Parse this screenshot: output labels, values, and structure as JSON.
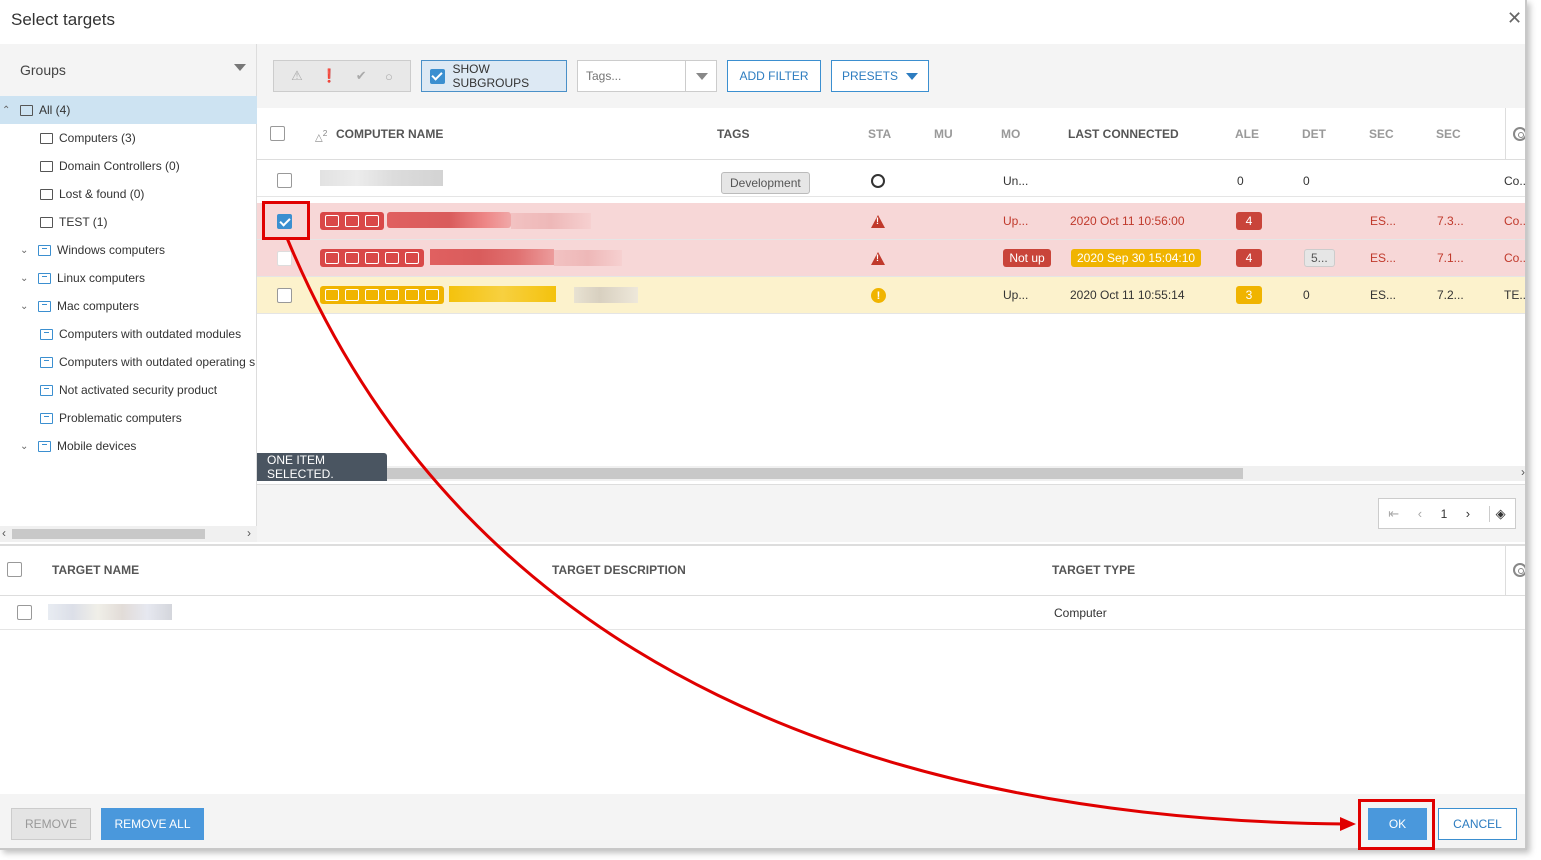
{
  "dialog": {
    "title": "Select targets"
  },
  "groups": {
    "header": "Groups",
    "items": [
      {
        "label": "All (4)",
        "level": 0,
        "expander": "collapse",
        "icon": "folder-icon",
        "active": true
      },
      {
        "label": "Computers (3)",
        "level": 1,
        "expander": "",
        "icon": "folder-icon"
      },
      {
        "label": "Domain Controllers (0)",
        "level": 1,
        "expander": "",
        "icon": "folder-icon"
      },
      {
        "label": "Lost & found (0)",
        "level": 1,
        "expander": "",
        "icon": "folder-icon"
      },
      {
        "label": "TEST (1)",
        "level": 1,
        "expander": "",
        "icon": "folder-icon"
      },
      {
        "label": "Windows computers",
        "level": 1,
        "expander": "expand",
        "icon": "dynamic-group-icon"
      },
      {
        "label": "Linux computers",
        "level": 1,
        "expander": "expand",
        "icon": "dynamic-group-icon"
      },
      {
        "label": "Mac computers",
        "level": 1,
        "expander": "expand",
        "icon": "dynamic-group-icon"
      },
      {
        "label": "Computers with outdated modules",
        "level": 2,
        "expander": "",
        "icon": "dynamic-group-icon"
      },
      {
        "label": "Computers with outdated operating s",
        "level": 2,
        "expander": "",
        "icon": "dynamic-group-icon"
      },
      {
        "label": "Not activated security product",
        "level": 2,
        "expander": "",
        "icon": "dynamic-group-icon"
      },
      {
        "label": "Problematic computers",
        "level": 2,
        "expander": "",
        "icon": "dynamic-group-icon"
      },
      {
        "label": "Mobile devices",
        "level": 1,
        "expander": "expand",
        "icon": "dynamic-group-icon"
      }
    ]
  },
  "toolbar": {
    "status_icons": [
      "⚠",
      "❗",
      "✔",
      "○"
    ],
    "show_subgroups": "SHOW SUBGROUPS",
    "tags_placeholder": "Tags...",
    "add_filter": "ADD FILTER",
    "presets": "PRESETS"
  },
  "grid": {
    "sort_indicator": "2",
    "columns": [
      "COMPUTER NAME",
      "TAGS",
      "STA",
      "MU",
      "MO",
      "LAST CONNECTED",
      "ALE",
      "DET",
      "SEC",
      "SEC"
    ],
    "rows": [
      {
        "state": "normal",
        "checked": false,
        "tag": "Development",
        "status": "circle",
        "mo": "Un...",
        "last_connected": "",
        "ale": "0",
        "det": "0",
        "sec1": "",
        "sec2": "",
        "last": "Co..."
      },
      {
        "state": "red",
        "checked": true,
        "tag": "",
        "status": "warning",
        "mo": "Up...",
        "last_connected": "2020 Oct 11 10:56:00",
        "ale": "4",
        "det": "",
        "sec1": "ES...",
        "sec2": "7.3...",
        "last": "Co..."
      },
      {
        "state": "red",
        "checked": false,
        "tag": "",
        "status": "warning",
        "mo": "Not up",
        "last_connected": "2020 Sep 30 15:04:10",
        "ale": "4",
        "det": "5...",
        "sec1": "ES...",
        "sec2": "7.1...",
        "last": "Co..."
      },
      {
        "state": "yellow",
        "checked": false,
        "tag": "",
        "status": "info",
        "mo": "Up...",
        "last_connected": "2020 Oct 11 10:55:14",
        "ale": "3",
        "det": "0",
        "sec1": "ES...",
        "sec2": "7.2...",
        "last": "TE..."
      }
    ],
    "selection_tip": "ONE ITEM SELECTED."
  },
  "pager": {
    "page": "1"
  },
  "targets": {
    "columns": [
      "TARGET NAME",
      "TARGET DESCRIPTION",
      "TARGET TYPE"
    ],
    "rows": [
      {
        "type": "Computer"
      }
    ]
  },
  "footer": {
    "remove": "REMOVE",
    "remove_all": "REMOVE ALL",
    "ok": "OK",
    "cancel": "CANCEL"
  },
  "colors": {
    "accent": "#3b8fd0",
    "danger": "#c0392b",
    "warning": "#f0b400",
    "annotation": "#e00000"
  }
}
